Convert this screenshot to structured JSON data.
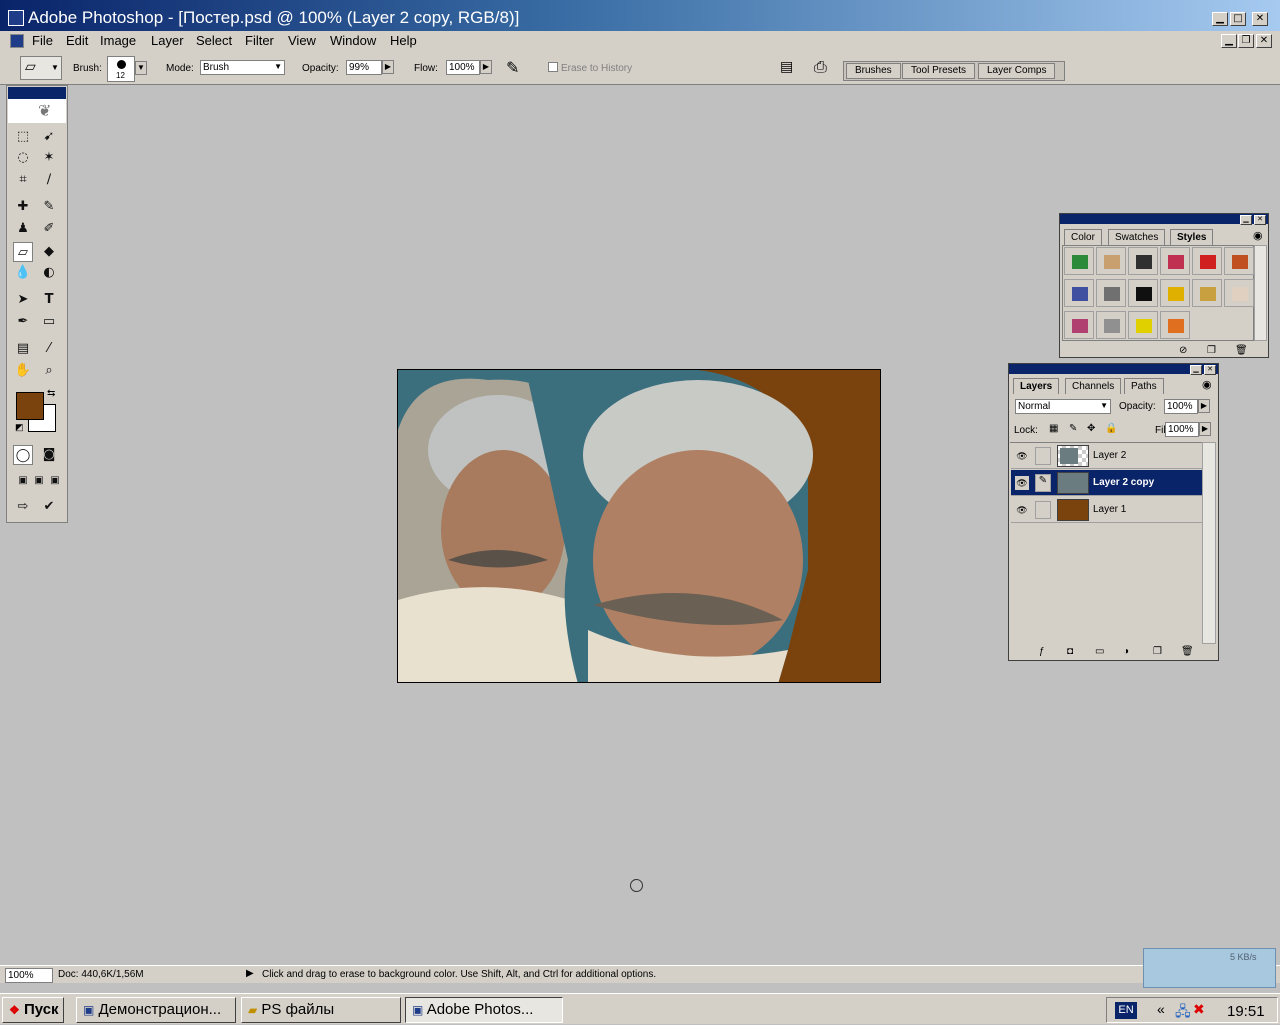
{
  "window": {
    "title": "Adobe Photoshop - [Постер.psd @ 100% (Layer 2 copy, RGB/8)]",
    "min_glyph": "▁",
    "max_glyph": "□",
    "close_glyph": "✕",
    "restore_glyph": "❐"
  },
  "menu": [
    "File",
    "Edit",
    "Image",
    "Layer",
    "Select",
    "Filter",
    "View",
    "Window",
    "Help"
  ],
  "options": {
    "brush_label": "Brush:",
    "brush_size": "12",
    "mode_label": "Mode:",
    "mode_value": "Brush",
    "opacity_label": "Opacity:",
    "opacity_value": "99%",
    "flow_label": "Flow:",
    "flow_value": "100%",
    "erase_history_label": "Erase to History",
    "well_tabs": [
      "Brushes",
      "Tool Presets",
      "Layer Comps"
    ]
  },
  "tools": {
    "text_tool_glyph": "T",
    "foreground_color": "#7a430d",
    "background_color": "#ffffff"
  },
  "styles_panel": {
    "tabs": [
      "Color",
      "Swatches",
      "Styles"
    ],
    "active_tab": "Styles",
    "swatch_colors": [
      "#2a8a3a",
      "#c8a070",
      "#303030",
      "#c03050",
      "#d02020",
      "#c05020",
      "#4050a0",
      "#707070",
      "#101010",
      "#e0b000",
      "#c8a040",
      "#e0d0c0",
      "#b04070",
      "#909090",
      "#e0d000",
      "#e07020"
    ]
  },
  "layers_panel": {
    "tabs": [
      "Layers",
      "Channels",
      "Paths"
    ],
    "active_tab": "Layers",
    "blend_mode": "Normal",
    "opacity_label": "Opacity:",
    "opacity_value": "100%",
    "lock_label": "Lock:",
    "fill_label": "Fill:",
    "fill_value": "100%",
    "layers": [
      {
        "name": "Layer 2",
        "selected": false
      },
      {
        "name": "Layer 2 copy",
        "selected": true
      },
      {
        "name": "Layer 1",
        "selected": false
      }
    ]
  },
  "statusbar": {
    "zoom": "100%",
    "doc_info": "Doc: 440,6K/1,56M",
    "hint": "Click and drag to erase to background color.  Use Shift, Alt, and Ctrl for additional options."
  },
  "network_widget": {
    "speed": "5 KB/s"
  },
  "taskbar": {
    "start_label": "Пуск",
    "buttons": [
      "Демонстрацион...",
      "PS файлы",
      "Adobe Photos..."
    ],
    "active_index": 2,
    "lang": "EN",
    "clock": "19:51"
  }
}
